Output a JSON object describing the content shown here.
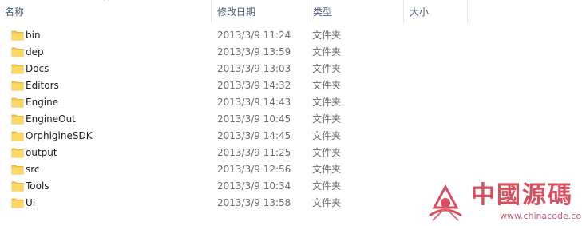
{
  "columns": {
    "name": "名称",
    "date": "修改日期",
    "type": "类型",
    "size": "大小"
  },
  "files": [
    {
      "name": "bin",
      "date": "2013/3/9 11:24",
      "type": "文件夹"
    },
    {
      "name": "dep",
      "date": "2013/3/9 13:59",
      "type": "文件夹"
    },
    {
      "name": "Docs",
      "date": "2013/3/9 13:03",
      "type": "文件夹"
    },
    {
      "name": "Editors",
      "date": "2013/3/9 14:32",
      "type": "文件夹"
    },
    {
      "name": "Engine",
      "date": "2013/3/9 14:43",
      "type": "文件夹"
    },
    {
      "name": "EngineOut",
      "date": "2013/3/9 10:45",
      "type": "文件夹"
    },
    {
      "name": "OrphigineSDK",
      "date": "2013/3/9 14:45",
      "type": "文件夹"
    },
    {
      "name": "output",
      "date": "2013/3/9 11:25",
      "type": "文件夹"
    },
    {
      "name": "src",
      "date": "2013/3/9 12:56",
      "type": "文件夹"
    },
    {
      "name": "Tools",
      "date": "2013/3/9 10:34",
      "type": "文件夹"
    },
    {
      "name": "UI",
      "date": "2013/3/9 13:58",
      "type": "文件夹"
    }
  ],
  "icons": {
    "sort": "sort-ascending-icon",
    "folder": "folder-icon"
  },
  "colors": {
    "header_text": "#4c607a",
    "folder": "#f5c848",
    "meta_text": "#6d6d6d",
    "watermark": "#d8505f"
  },
  "watermark": {
    "title": "中國源碼",
    "url": "www.chinacode.com"
  }
}
